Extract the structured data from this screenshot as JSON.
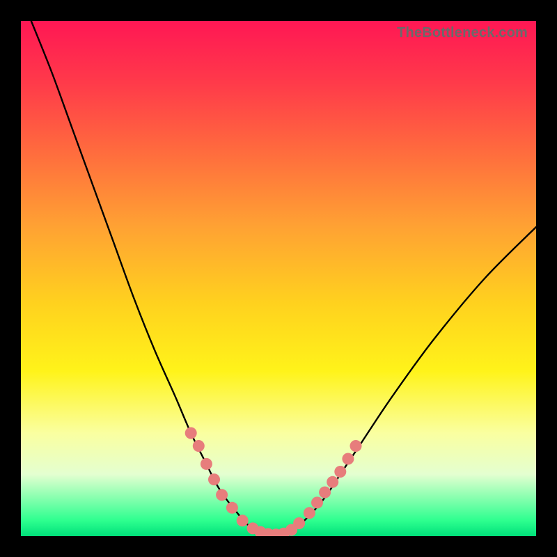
{
  "watermark": "TheBottleneck.com",
  "colors": {
    "curve": "#000000",
    "marker_fill": "#e77d7c",
    "marker_stroke": "#d85f5e",
    "gradient_top": "#ff1754",
    "gradient_bottom": "#00e07a"
  },
  "chart_data": {
    "type": "line",
    "title": "",
    "xlabel": "",
    "ylabel": "",
    "xlim": [
      0,
      100
    ],
    "ylim": [
      0,
      100
    ],
    "note": "Values estimated from pixel positions; x and y in percent of plot area (y=0 at bottom).",
    "series": [
      {
        "name": "curve",
        "x": [
          2,
          6,
          10,
          14,
          18,
          22,
          26,
          30,
          33,
          36,
          38,
          40,
          42,
          43.5,
          45,
          47,
          49,
          51,
          53.5,
          56,
          59,
          62,
          66,
          72,
          80,
          90,
          100
        ],
        "y": [
          100,
          90,
          79,
          68,
          57,
          46,
          36,
          27,
          20,
          14,
          10,
          7,
          4.5,
          2.7,
          1.5,
          0.6,
          0.3,
          0.6,
          1.8,
          4,
          7.5,
          12,
          18,
          27,
          38,
          50,
          60
        ]
      }
    ],
    "markers": {
      "name": "highlighted-points",
      "points": [
        {
          "x": 33.0,
          "y": 20.0
        },
        {
          "x": 34.5,
          "y": 17.5
        },
        {
          "x": 36.0,
          "y": 14.0
        },
        {
          "x": 37.5,
          "y": 11.0
        },
        {
          "x": 39.0,
          "y": 8.0
        },
        {
          "x": 41.0,
          "y": 5.5
        },
        {
          "x": 43.0,
          "y": 3.0
        },
        {
          "x": 45.0,
          "y": 1.5
        },
        {
          "x": 46.5,
          "y": 0.8
        },
        {
          "x": 48.0,
          "y": 0.4
        },
        {
          "x": 49.5,
          "y": 0.3
        },
        {
          "x": 51.0,
          "y": 0.5
        },
        {
          "x": 52.5,
          "y": 1.2
        },
        {
          "x": 54.0,
          "y": 2.5
        },
        {
          "x": 56.0,
          "y": 4.5
        },
        {
          "x": 57.5,
          "y": 6.5
        },
        {
          "x": 59.0,
          "y": 8.5
        },
        {
          "x": 60.5,
          "y": 10.5
        },
        {
          "x": 62.0,
          "y": 12.5
        },
        {
          "x": 63.5,
          "y": 15.0
        },
        {
          "x": 65.0,
          "y": 17.5
        }
      ]
    }
  }
}
